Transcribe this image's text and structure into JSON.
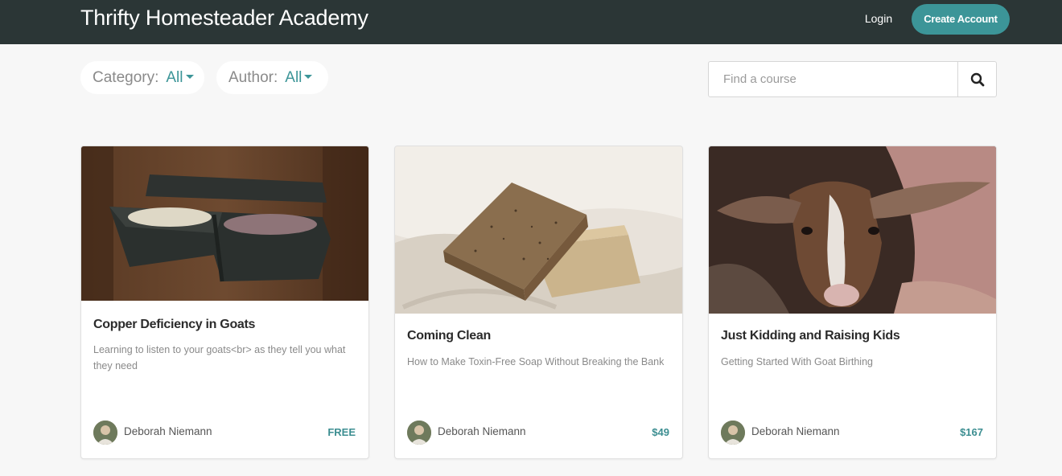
{
  "header": {
    "brand": "Thrifty Homesteader Academy",
    "login": "Login",
    "create_account": "Create Account"
  },
  "filters": {
    "category": {
      "label": "Category:",
      "value": "All"
    },
    "author": {
      "label": "Author:",
      "value": "All"
    }
  },
  "search": {
    "placeholder": "Find a course"
  },
  "courses": [
    {
      "title": "Copper Deficiency in Goats",
      "subtitle": "Learning to listen to your goats<br> as they tell you what they need",
      "author": "Deborah Niemann",
      "price": "FREE"
    },
    {
      "title": "Coming Clean",
      "subtitle": "How to Make Toxin-Free Soap Without Breaking the Bank",
      "author": "Deborah Niemann",
      "price": "$49"
    },
    {
      "title": "Just Kidding and Raising Kids",
      "subtitle": "Getting Started With Goat Birthing",
      "author": "Deborah Niemann",
      "price": "$167"
    }
  ],
  "colors": {
    "navbar": "#2b3636",
    "accent": "#3c9598",
    "background": "#f7f7f7"
  },
  "icons": {
    "search": "search-icon",
    "caret": "caret-down-icon"
  }
}
